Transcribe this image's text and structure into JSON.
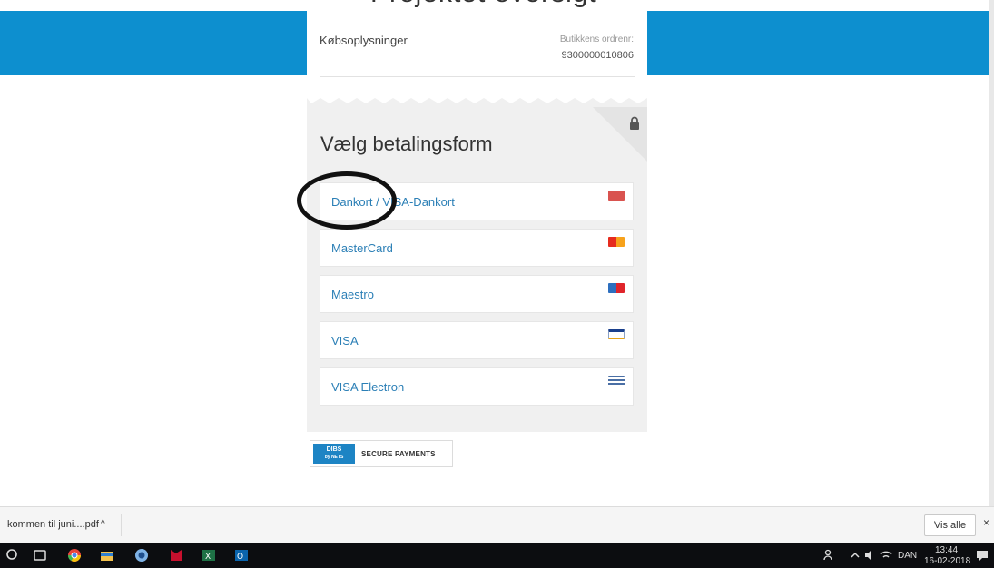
{
  "receipt": {
    "cut_title": "Projektet oversigt",
    "label": "Købsoplysninger",
    "order_label": "Butikkens ordrenr:",
    "order_number": "9300000010806"
  },
  "payment": {
    "title": "Vælg betalingsform",
    "methods": [
      {
        "label": "Dankort / VISA-Dankort",
        "icon": "dankort-card-icon",
        "color": "#d9534f"
      },
      {
        "label": "MasterCard",
        "icon": "mastercard-card-icon",
        "color": "#e8a317"
      },
      {
        "label": "Maestro",
        "icon": "maestro-card-icon",
        "color": "#2d6fbf"
      },
      {
        "label": "VISA",
        "icon": "visa-card-icon",
        "color": "#1a3f8c"
      },
      {
        "label": "VISA Electron",
        "icon": "visa-electron-card-icon",
        "color": "#4a6fa5"
      }
    ]
  },
  "badge": {
    "logo_line1": "DIBS",
    "logo_line2": "by NETS",
    "text": "SECURE PAYMENTS"
  },
  "download_bar": {
    "file_name": "kommen til juni....pdf",
    "caret": "^",
    "show_all": "Vis alle",
    "close": "×"
  },
  "taskbar": {
    "language": "DAN",
    "time": "13:44",
    "date": "16-02-2018"
  },
  "colors": {
    "accent_blue": "#0d8fcf",
    "link_blue": "#2b7fb6"
  }
}
